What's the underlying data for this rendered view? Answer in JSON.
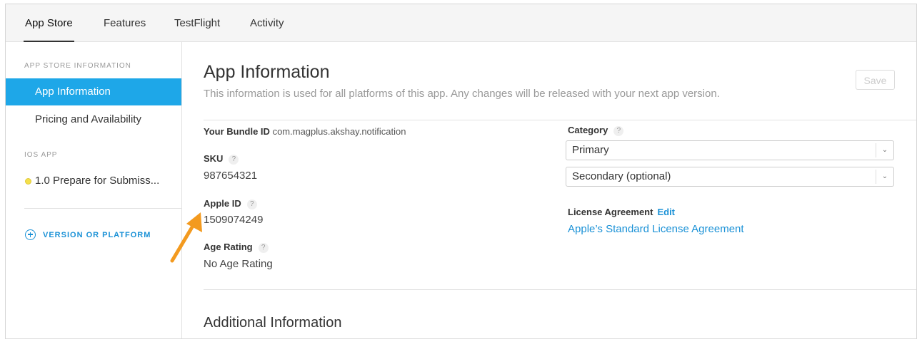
{
  "nav": {
    "tabs": [
      {
        "label": "App Store",
        "active": true
      },
      {
        "label": "Features",
        "active": false
      },
      {
        "label": "TestFlight",
        "active": false
      },
      {
        "label": "Activity",
        "active": false
      }
    ]
  },
  "sidebar": {
    "section_app_store": "APP STORE INFORMATION",
    "items": [
      {
        "label": "App Information",
        "active": true
      },
      {
        "label": "Pricing and Availability",
        "active": false
      }
    ],
    "section_ios": "IOS APP",
    "ios_items": [
      {
        "label": "1.0 Prepare for Submiss...",
        "status_color": "#f4e04b"
      }
    ],
    "add_version_label": "VERSION OR PLATFORM"
  },
  "main": {
    "title": "App Information",
    "subtitle": "This information is used for all platforms of this app. Any changes will be released with your next app version.",
    "save_label": "Save",
    "bundle_id_label": "Your Bundle ID",
    "bundle_id_value": "com.magplus.akshay.notification",
    "sku_label": "SKU",
    "sku_value": "987654321",
    "apple_id_label": "Apple ID",
    "apple_id_value": "1509074249",
    "age_rating_label": "Age Rating",
    "age_rating_value": "No Age Rating",
    "category_label": "Category",
    "primary_select": "Primary",
    "secondary_select": "Secondary (optional)",
    "license_label": "License Agreement",
    "license_edit": "Edit",
    "license_link": "Apple’s Standard License Agreement",
    "additional_title": "Additional Information",
    "help_glyph": "?"
  },
  "colors": {
    "accent": "#1ea7e8",
    "link": "#1a91d6",
    "annotation_arrow": "#f39a1f"
  }
}
